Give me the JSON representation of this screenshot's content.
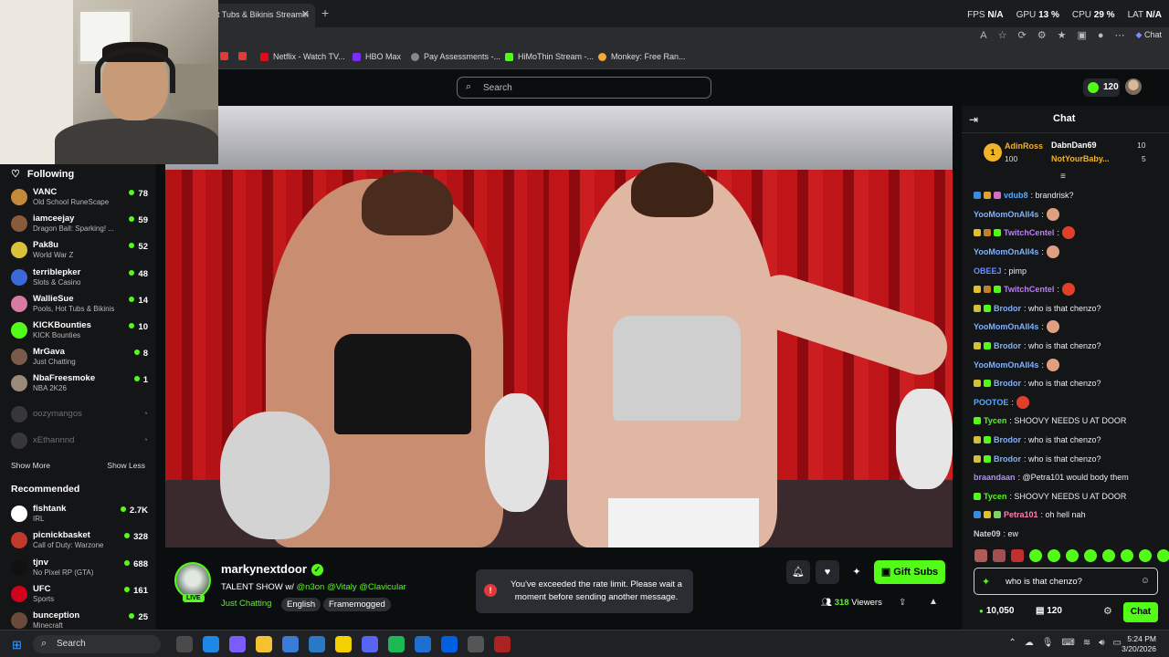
{
  "browser": {
    "active_tab": "t Tubs & Bikinis Streamin",
    "perf": {
      "fps_label": "FPS",
      "fps": "N/A",
      "gpu_label": "GPU",
      "gpu": "13 %",
      "cpu_label": "CPU",
      "cpu": "29 %",
      "lat_label": "LAT",
      "lat": "N/A"
    },
    "chat_button": "Chat",
    "bookmarks": [
      {
        "label": "Netflix - Watch TV...",
        "color": "#e50914"
      },
      {
        "label": "HBO Max",
        "color": "#7b2cff"
      },
      {
        "label": "Pay Assessments -...",
        "color": "#888888"
      },
      {
        "label": "HiMoThin Stream -...",
        "color": "#53fc18"
      },
      {
        "label": "Monkey: Free Ran...",
        "color": "#f2a93b"
      }
    ]
  },
  "kick": {
    "search_placeholder": "Search",
    "coins": "120"
  },
  "sidebar": {
    "following_label": "Following",
    "channels": [
      {
        "name": "VANC",
        "category": "Old School RuneScape",
        "viewers": "78",
        "color": "#c48a3a",
        "live": true
      },
      {
        "name": "iamceejay",
        "category": "Dragon Ball: Sparking! ...",
        "viewers": "59",
        "color": "#8a5a3d",
        "live": true
      },
      {
        "name": "Pak8u",
        "category": "World War Z",
        "viewers": "52",
        "color": "#d9c23a",
        "live": true
      },
      {
        "name": "terriblepker",
        "category": "Slots & Casino",
        "viewers": "48",
        "color": "#3a6ad9",
        "live": true
      },
      {
        "name": "WallieSue",
        "category": "Pools, Hot Tubs & Bikinis",
        "viewers": "14",
        "color": "#d97aa3",
        "live": true
      },
      {
        "name": "KICKBounties",
        "category": "KICK Bounties",
        "viewers": "10",
        "color": "#53fc18",
        "live": true
      },
      {
        "name": "MrGava",
        "category": "Just Chatting",
        "viewers": "8",
        "color": "#7a5a4a",
        "live": true
      },
      {
        "name": "NbaFreesmoke",
        "category": "NBA 2K26",
        "viewers": "1",
        "color": "#9a8a7a",
        "live": true
      },
      {
        "name": "oozymangos",
        "category": "",
        "viewers": "◔",
        "color": "#777777",
        "live": false
      },
      {
        "name": "xEthannnd",
        "category": "",
        "viewers": "◔",
        "color": "#777777",
        "live": false
      }
    ],
    "show_more": "Show More",
    "show_less": "Show Less",
    "recommended_label": "Recommended",
    "recommended": [
      {
        "name": "fishtank",
        "category": "IRL",
        "viewers": "2.7K",
        "color": "#ffffff"
      },
      {
        "name": "picnickbasket",
        "category": "Call of Duty: Warzone",
        "viewers": "328",
        "color": "#c0392b"
      },
      {
        "name": "tjnv",
        "category": "No Pixel RP (GTA)",
        "viewers": "688",
        "color": "#111111"
      },
      {
        "name": "UFC",
        "category": "Sports",
        "viewers": "161",
        "color": "#d0021b"
      },
      {
        "name": "bunception",
        "category": "Minecraft",
        "viewers": "25",
        "color": "#6a4a3a"
      }
    ]
  },
  "stream": {
    "channel": "markynextdoor",
    "live_badge": "LIVE",
    "title_prefix": "TALENT SHOW w/ ",
    "title_tags": "@n3on @Vitaly @Clavicular",
    "category": "Just Chatting",
    "tag1": "English",
    "tag2": "Framemogged",
    "gift_subs": "Gift Subs",
    "viewer_count": "318",
    "viewers_label": "Viewers"
  },
  "toast": {
    "message": "You've exceeded the rate limit. Please wait a moment before sending another message."
  },
  "chat": {
    "title": "Chat",
    "pinned": {
      "rank": "1",
      "top_user": "AdinRoss",
      "top_value": "100",
      "user2": "DabnDan69",
      "value2": "10",
      "user3": "NotYourBaby...",
      "value3": "5"
    },
    "messages": [
      {
        "user": "vdub8",
        "text": ": brandrisk?",
        "color": "#5aa9ff",
        "badges": [
          "#3a8dde",
          "#e0a030",
          "#d070c0"
        ],
        "emote": ""
      },
      {
        "user": "YooMomOnAll4s",
        "text": ":",
        "color": "#7fb2ff",
        "badges": [],
        "emote": "#e0a080"
      },
      {
        "user": "TwitchCentel",
        "text": ":",
        "color": "#c07aff",
        "badges": [
          "#e0c030",
          "#c08030",
          "#53fc18"
        ],
        "emote": "#e0402a"
      },
      {
        "user": "YooMomOnAll4s",
        "text": ":",
        "color": "#7fb2ff",
        "badges": [],
        "emote": "#e0a080"
      },
      {
        "user": "OBEEJ",
        "text": ": pimp",
        "color": "#6f8cff",
        "badges": [],
        "emote": ""
      },
      {
        "user": "TwitchCentel",
        "text": ":",
        "color": "#c07aff",
        "badges": [
          "#e0c030",
          "#c08030",
          "#53fc18"
        ],
        "emote": "#e0402a"
      },
      {
        "user": "Brodor",
        "text": ": who is that chenzo?",
        "color": "#7fb2ff",
        "badges": [
          "#d0c040",
          "#53fc18"
        ],
        "emote": ""
      },
      {
        "user": "YooMomOnAll4s",
        "text": ":",
        "color": "#7fb2ff",
        "badges": [],
        "emote": "#e0a080"
      },
      {
        "user": "Brodor",
        "text": ": who is that chenzo?",
        "color": "#7fb2ff",
        "badges": [
          "#d0c040",
          "#53fc18"
        ],
        "emote": ""
      },
      {
        "user": "YooMomOnAll4s",
        "text": ":",
        "color": "#7fb2ff",
        "badges": [],
        "emote": "#e0a080"
      },
      {
        "user": "Brodor",
        "text": ": who is that chenzo?",
        "color": "#7fb2ff",
        "badges": [
          "#d0c040",
          "#53fc18"
        ],
        "emote": ""
      },
      {
        "user": "POOTOE",
        "text": ":",
        "color": "#5aa9ff",
        "badges": [],
        "emote": "#e0402a"
      },
      {
        "user": "Tycen",
        "text": ": SHOOVY NEEDS U AT DOOR",
        "color": "#53fc18",
        "badges": [
          "#53fc18"
        ],
        "emote": ""
      },
      {
        "user": "Brodor",
        "text": ": who is that chenzo?",
        "color": "#7fb2ff",
        "badges": [
          "#d0c040",
          "#53fc18"
        ],
        "emote": ""
      },
      {
        "user": "Brodor",
        "text": ": who is that chenzo?",
        "color": "#7fb2ff",
        "badges": [
          "#d0c040",
          "#53fc18"
        ],
        "emote": ""
      },
      {
        "user": "braandaan",
        "text": ": @Petra101 would body them",
        "color": "#b48cff",
        "badges": [],
        "emote": ""
      },
      {
        "user": "Tycen",
        "text": ": SHOOVY NEEDS U AT DOOR",
        "color": "#53fc18",
        "badges": [
          "#53fc18"
        ],
        "emote": ""
      },
      {
        "user": "Petra101",
        "text": ": oh hell nah",
        "color": "#ff7fb2",
        "badges": [
          "#3a8dde",
          "#e0c030",
          "#7fd06a"
        ],
        "emote": ""
      },
      {
        "user": "Nate09",
        "text": ": ew",
        "color": "#cfcfcf",
        "badges": [],
        "emote": ""
      }
    ],
    "emote_colors": [
      "#b05a5a",
      "#a05050",
      "#c03030",
      "#53fc18",
      "#53fc18",
      "#53fc18",
      "#53fc18",
      "#53fc18",
      "#53fc18",
      "#53fc18",
      "#53fc18",
      "#53fc18",
      "#53fc18"
    ],
    "input_value": "who is that chenzo?",
    "balance": "10,050",
    "gems": "120",
    "send_label": "Chat"
  },
  "taskbar": {
    "search_label": "Search",
    "time": "5:24 PM",
    "date": "3/20/2026",
    "app_colors": [
      "#4a4a4a",
      "#1e88e5",
      "#7b5cff",
      "#f2c230",
      "#3a7bd5",
      "#2a79c7",
      "#f5d000",
      "#5865f2",
      "#1db954",
      "#1f6fd1",
      "#0060df",
      "#555555",
      "#aa2222"
    ]
  },
  "colors": {
    "accent": "#53fc18",
    "background": "#0b0e0f",
    "panel": "#141517"
  }
}
